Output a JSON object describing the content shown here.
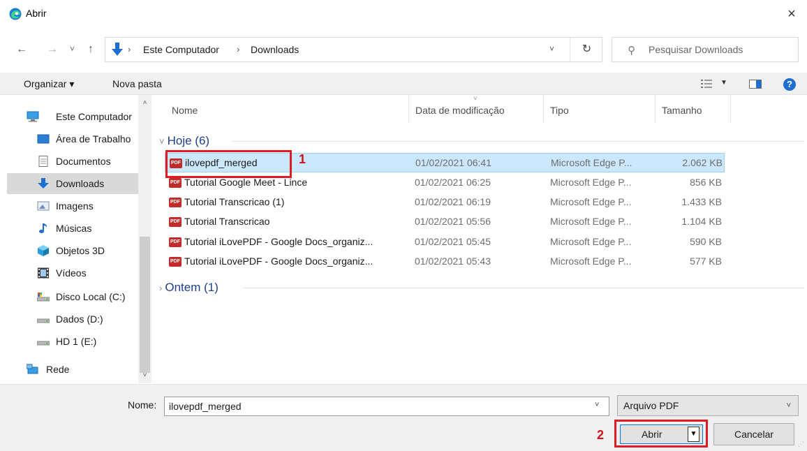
{
  "window": {
    "title": "Abrir",
    "close_glyph": "×"
  },
  "nav": {
    "back_glyph": "←",
    "forward_glyph": "→",
    "recent_glyph": "˅",
    "up_glyph": "↑",
    "breadcrumb": [
      "Este Computador",
      "Downloads"
    ],
    "separator": "›",
    "dropdown_glyph": "˅",
    "refresh_glyph": "↻",
    "search_placeholder": "Pesquisar Downloads"
  },
  "toolbar": {
    "organize": "Organizar ▾",
    "new_folder": "Nova pasta",
    "view_caret": "▼",
    "help": "?"
  },
  "sidebar": {
    "items": [
      {
        "label": "Este Computador",
        "icon": "computer-icon"
      },
      {
        "label": "Área de Trabalho",
        "icon": "desktop-icon"
      },
      {
        "label": "Documentos",
        "icon": "documents-icon"
      },
      {
        "label": "Downloads",
        "icon": "downloads-icon"
      },
      {
        "label": "Imagens",
        "icon": "pictures-icon"
      },
      {
        "label": "Músicas",
        "icon": "music-icon"
      },
      {
        "label": "Objetos 3D",
        "icon": "objects-3d-icon"
      },
      {
        "label": "Vídeos",
        "icon": "videos-icon"
      },
      {
        "label": "Disco Local (C:)",
        "icon": "drive-c-icon"
      },
      {
        "label": "Dados (D:)",
        "icon": "drive-d-icon"
      },
      {
        "label": "HD 1 (E:)",
        "icon": "drive-e-icon"
      },
      {
        "label": "Rede",
        "icon": "network-icon"
      }
    ],
    "selected": "Downloads",
    "scroll_up": "˄",
    "scroll_down": "˅"
  },
  "columns": {
    "name": "Nome",
    "date": "Data de modificação",
    "type": "Tipo",
    "size": "Tamanho"
  },
  "groups": {
    "today": "Hoje (6)",
    "yesterday": "Ontem (1)",
    "expanded_glyph": "˅",
    "collapsed_glyph": "›"
  },
  "files": [
    {
      "name": "ilovepdf_merged",
      "date": "01/02/2021 06:41",
      "type": "Microsoft Edge P...",
      "size": "2.062 KB"
    },
    {
      "name": "Tutorial Google Meet - Lince",
      "date": "01/02/2021 06:25",
      "type": "Microsoft Edge P...",
      "size": "856 KB"
    },
    {
      "name": "Tutorial Transcricao (1)",
      "date": "01/02/2021 06:19",
      "type": "Microsoft Edge P...",
      "size": "1.433 KB"
    },
    {
      "name": "Tutorial Transcricao",
      "date": "01/02/2021 05:56",
      "type": "Microsoft Edge P...",
      "size": "1.104 KB"
    },
    {
      "name": "Tutorial iLovePDF - Google Docs_organiz...",
      "date": "01/02/2021 05:45",
      "type": "Microsoft Edge P...",
      "size": "590 KB"
    },
    {
      "name": "Tutorial iLovePDF - Google Docs_organiz...",
      "date": "01/02/2021 05:43",
      "type": "Microsoft Edge P...",
      "size": "577 KB"
    }
  ],
  "pdf_badge": "PDF",
  "footer": {
    "name_label": "Nome:",
    "name_value": "ilovepdf_merged",
    "name_dropdown": "˅",
    "file_type": "Arquivo PDF",
    "file_type_caret": "˅",
    "open": "Abrir",
    "open_split": "▼",
    "cancel": "Cancelar"
  },
  "annotations": {
    "step1": "1",
    "step2": "2"
  },
  "colors": {
    "accent": "#0078d7",
    "selection": "#cce8ff",
    "annotation": "#e01b24",
    "group_header": "#1e3f8a"
  }
}
